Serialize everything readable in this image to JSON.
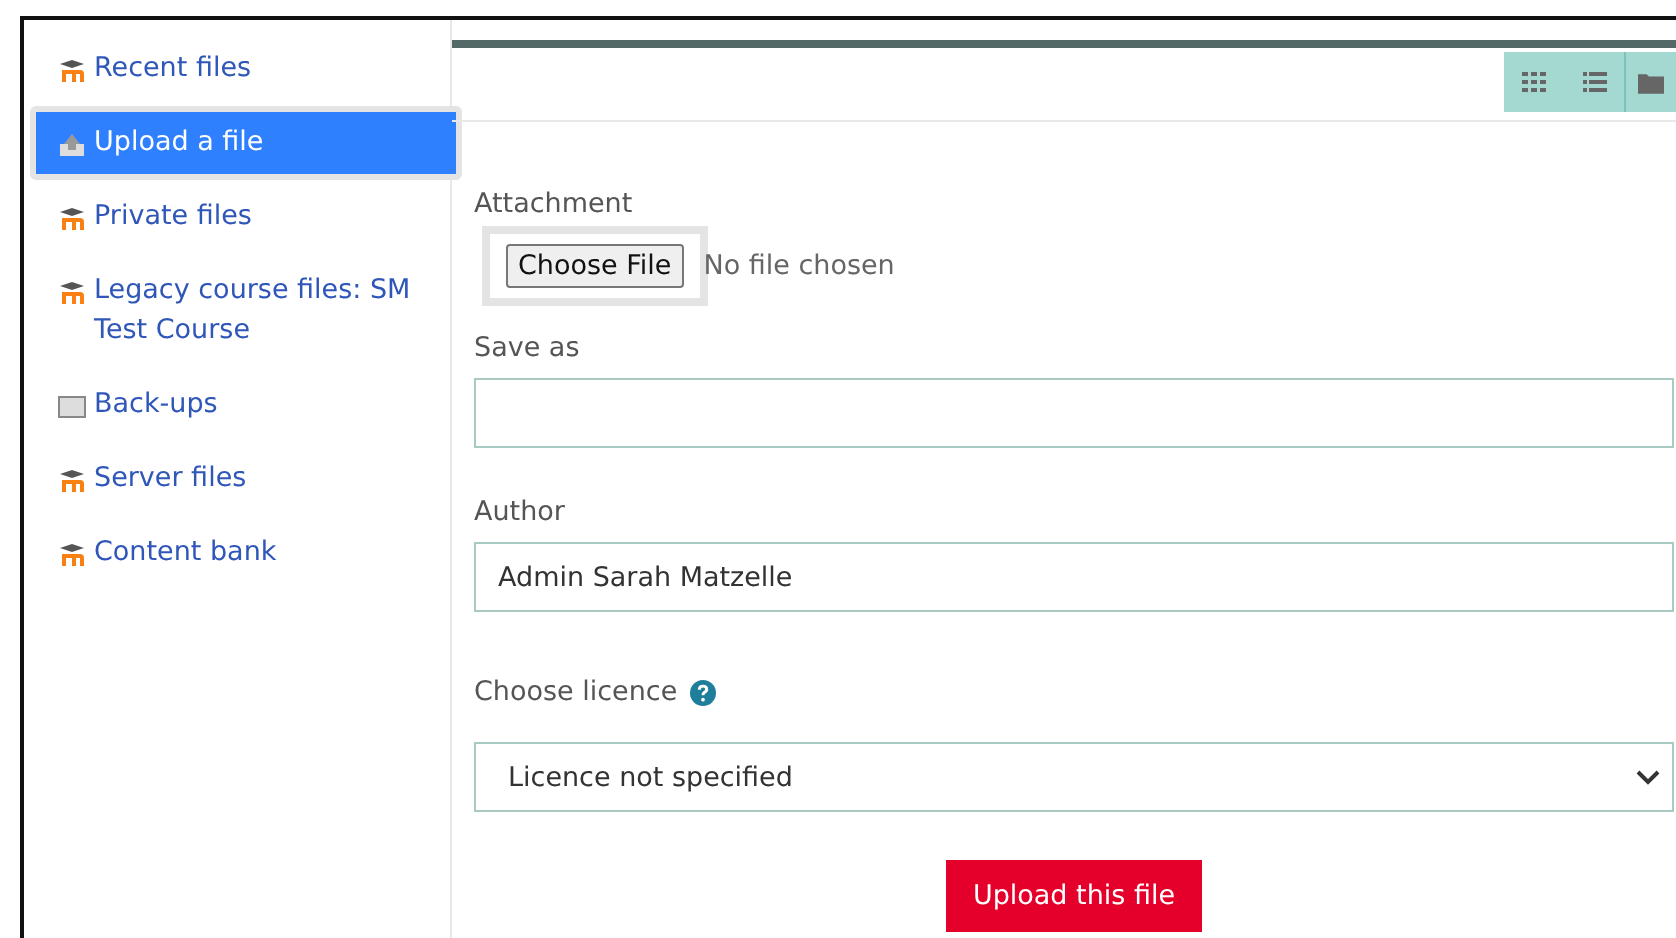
{
  "sidebar": {
    "items": [
      {
        "label": "Recent files",
        "kind": "moodle",
        "selected": false
      },
      {
        "label": "Upload a file",
        "kind": "upload",
        "selected": true
      },
      {
        "label": "Private files",
        "kind": "moodle",
        "selected": false
      },
      {
        "label": "Legacy course files: SM Test Course",
        "kind": "moodle",
        "selected": false
      },
      {
        "label": "Back-ups",
        "kind": "box",
        "selected": false
      },
      {
        "label": "Server files",
        "kind": "moodle",
        "selected": false
      },
      {
        "label": "Content bank",
        "kind": "moodle",
        "selected": false
      }
    ]
  },
  "form": {
    "attachment": {
      "label": "Attachment",
      "button": "Choose File",
      "status": "No file chosen"
    },
    "save_as": {
      "label": "Save as"
    },
    "author": {
      "label": "Author",
      "value": "Admin Sarah Matzelle"
    },
    "licence": {
      "label": "Choose licence",
      "value": "Licence not specified"
    },
    "submit": "Upload this file"
  }
}
